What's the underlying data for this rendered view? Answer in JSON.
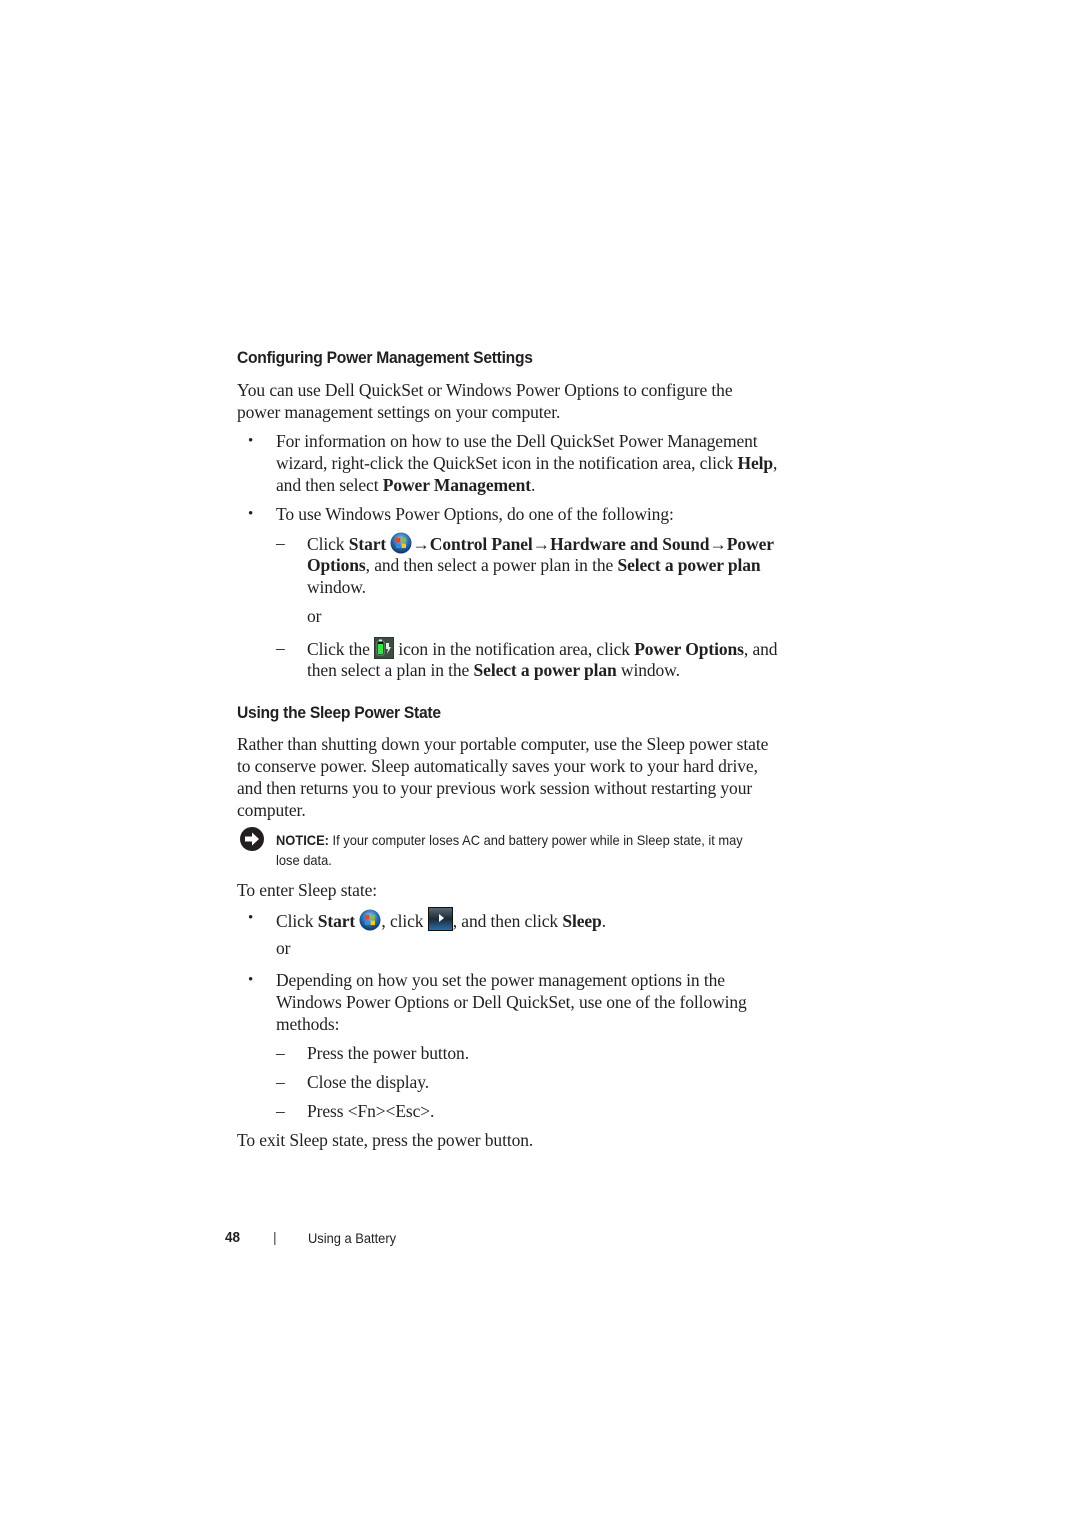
{
  "section1": {
    "heading": "Configuring Power Management Settings",
    "intro_line1": "You can use Dell QuickSet or Windows Power Options to configure the",
    "intro_line2": "power management settings on your computer.",
    "bullet1": {
      "line1": "For information on how to use the Dell QuickSet Power Management",
      "line2_pre": "wizard, right-click the QuickSet icon in the notification area, click ",
      "line2_bold": "Help",
      "line2_post": ",",
      "line3_pre": "and then select ",
      "line3_bold": "Power Management",
      "line3_post": "."
    },
    "bullet2": {
      "text": "To use Windows Power Options, do one of the following:"
    },
    "dash1": {
      "pre": "Click ",
      "start": "Start",
      "path": "→Control Panel→Hardware and Sound→Power",
      "line2_bold1": "Options",
      "line2_mid": ", and then select a power plan in the ",
      "line2_bold2": "Select a power plan",
      "line3": "window."
    },
    "or1": "or",
    "dash2": {
      "pre": "Click the ",
      "mid": " icon in the notification area, click ",
      "bold1": "Power Options",
      "post": ", and",
      "line2_pre": "then select a plan in the ",
      "line2_bold": "Select a power plan",
      "line2_post": " window."
    }
  },
  "section2": {
    "heading": "Using the Sleep Power State",
    "para_line1": "Rather than shutting down your portable computer, use the Sleep power state",
    "para_line2": "to conserve power. Sleep automatically saves your work to your hard drive,",
    "para_line3": "and then returns you to your previous work session without restarting your",
    "para_line4": "computer.",
    "notice": {
      "label": "NOTICE:",
      "line1": " If your computer loses AC and battery power while in Sleep state, it may",
      "line2": "lose data."
    },
    "enter_label": "To enter Sleep state:",
    "bullet1": {
      "pre": "Click ",
      "start": "Start",
      "mid": ", click ",
      "post": ", and then click ",
      "sleep": "Sleep",
      "end": "."
    },
    "or2": "or",
    "bullet2": {
      "line1": "Depending on how you set the power management options in the",
      "line2": "Windows Power Options or Dell QuickSet, use one of the following",
      "line3": "methods:"
    },
    "methods": [
      "Press the power button.",
      "Close the display.",
      "Press <Fn><Esc>."
    ],
    "exit_text": "To exit Sleep state, press the power button."
  },
  "footer": {
    "page_number": "48",
    "separator": "|",
    "chapter": "Using a Battery"
  },
  "icons": {
    "start": "windows-start-orb-icon",
    "battery": "battery-power-icon",
    "power_arrow": "power-arrow-button-icon",
    "notice": "notice-arrow-icon"
  },
  "symbols": {
    "bullet": "•",
    "dash": "–"
  }
}
